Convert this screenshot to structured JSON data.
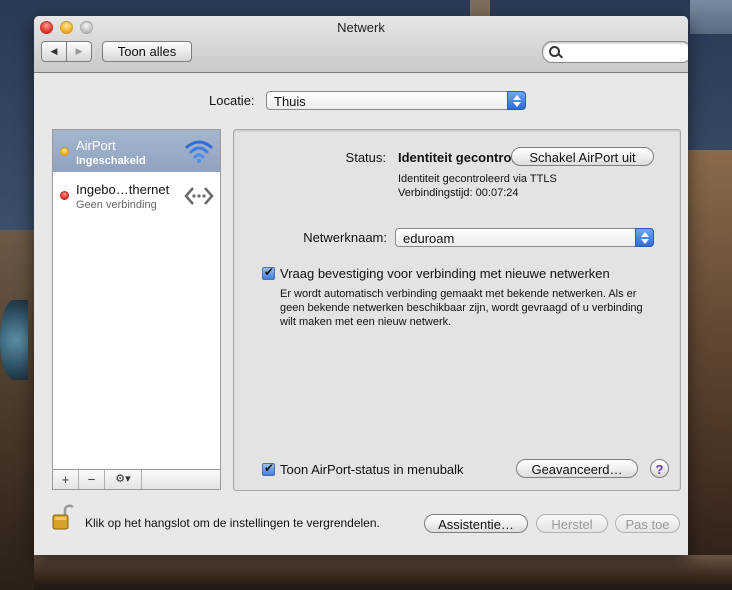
{
  "window": {
    "title": "Netwerk"
  },
  "toolbar": {
    "back": "◀",
    "forward": "▶",
    "show_all": "Toon alles",
    "search_placeholder": ""
  },
  "location": {
    "label": "Locatie:",
    "value": "Thuis"
  },
  "sidebar": {
    "services": [
      {
        "name": "AirPort",
        "status": "Ingeschakeld",
        "dot_color": "#e8a10a",
        "icon": "wifi-icon"
      },
      {
        "name": "Ingebo…thernet",
        "status": "Geen verbinding",
        "dot_color": "#d81e12",
        "icon": "ethernet-icon"
      }
    ],
    "add": "+",
    "remove": "−",
    "gear": "⚙▾"
  },
  "panel": {
    "status_label": "Status:",
    "status_value": "Identiteit gecontroleerd",
    "turn_off_button": "Schakel AirPort uit",
    "status_detail_1": "Identiteit gecontroleerd via TTLS",
    "status_detail_2": "Verbindingstijd: 00:07:24",
    "network_label": "Netwerknaam:",
    "network_value": "eduroam",
    "ask_checkbox_label": "Vraag bevestiging voor verbinding met nieuwe netwerken",
    "ask_description_1": "Er wordt automatisch verbinding gemaakt met bekende netwerken. Als er",
    "ask_description_2": "geen bekende netwerken beschikbaar zijn, wordt gevraagd of u verbinding",
    "ask_description_3": "wilt maken met een nieuw netwerk.",
    "show_status_label": "Toon AirPort-status in menubalk",
    "advanced_button": "Geavanceerd…",
    "help": "?"
  },
  "footer": {
    "lock_text": "Klik op het hangslot om de instellingen te vergrendelen.",
    "assist_button": "Assistentie…",
    "revert_button": "Herstel",
    "apply_button": "Pas toe"
  },
  "colors": {
    "selection": "#8fa2c0",
    "accent": "#3f7fdc"
  }
}
